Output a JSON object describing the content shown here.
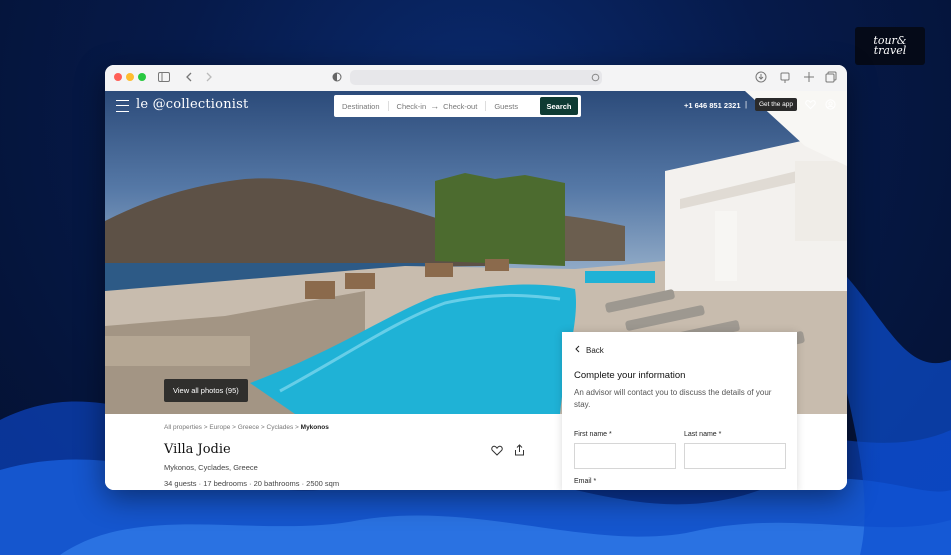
{
  "badge": {
    "line1": "tour&",
    "line2": "travel"
  },
  "site": {
    "brand": "le @collectionist",
    "search": {
      "destination": "Destination",
      "checkin": "Check-in",
      "arrow": "→",
      "checkout": "Check-out",
      "guests": "Guests",
      "button": "Search"
    },
    "phone": "+1 646 851 2321",
    "pipe": "|",
    "get_app": "Get the app"
  },
  "hero": {
    "view_all_photos": "View all photos (95)"
  },
  "breadcrumb": {
    "items": [
      "All properties",
      "Europe",
      "Greece",
      "Cyclades"
    ],
    "sep": ">",
    "current": "Mykonos"
  },
  "property": {
    "title": "Villa Jodie",
    "location": "Mykonos,  Cyclades,  Greece",
    "stats": "34 guests  ·  17 bedrooms  ·  20 bathrooms  ·  2500 sqm"
  },
  "panel": {
    "back": "Back",
    "title": "Complete your information",
    "description": "An advisor will contact you to discuss the details of your stay.",
    "first_name_label": "First name *",
    "last_name_label": "Last name *",
    "email_label": "Email *",
    "first_name_value": "",
    "last_name_value": ""
  },
  "colors": {
    "search_button": "#0e3b33",
    "pool": "#1fb2d6",
    "desktop": "#061a4a"
  }
}
